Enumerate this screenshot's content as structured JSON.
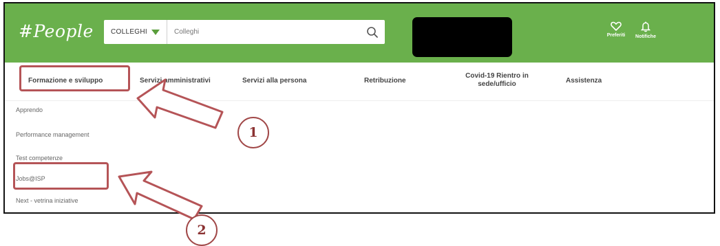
{
  "app": {
    "logo": "#People"
  },
  "search": {
    "scope_value": "COLLEGHI",
    "placeholder": "Colleghi"
  },
  "top_actions": [
    {
      "label": "Preferiti",
      "icon": "heart-icon"
    },
    {
      "label": "Notifiche",
      "icon": "bell-icon"
    }
  ],
  "nav": {
    "items": [
      {
        "label": "Formazione e sviluppo"
      },
      {
        "label": "Servizi amministrativi"
      },
      {
        "label": "Servizi alla persona"
      },
      {
        "label": "Retribuzione"
      },
      {
        "label": "Covid-19 Rientro in sede/ufficio"
      },
      {
        "label": "Assistenza"
      }
    ]
  },
  "submenu": {
    "items": [
      {
        "label": "Apprendo"
      },
      {
        "label": "Performance management"
      },
      {
        "label": "Test competenze"
      },
      {
        "label": "Jobs@ISP"
      },
      {
        "label": "Next - vetrina iniziative"
      }
    ]
  },
  "callouts": [
    {
      "number": "1"
    },
    {
      "number": "2"
    }
  ],
  "colors": {
    "brand_green": "#6ab04c",
    "highlight_red": "#b55457",
    "badge_red": "#a14848"
  }
}
